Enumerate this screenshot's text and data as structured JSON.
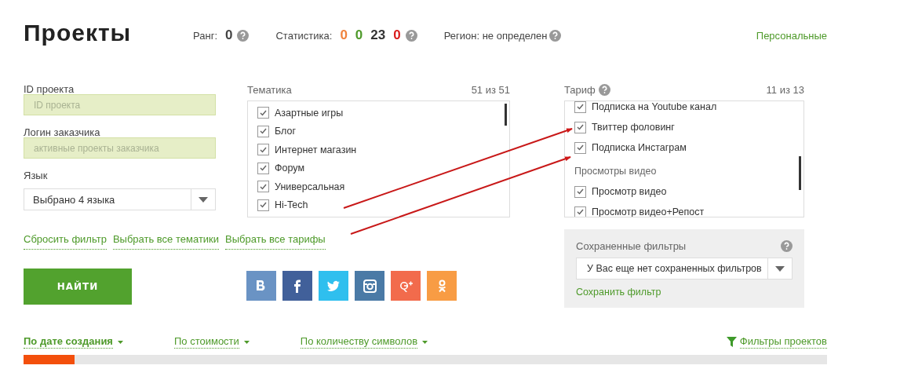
{
  "header": {
    "title": "Проекты",
    "rank_label": "Ранг:",
    "rank": "0",
    "stats_label": "Статистика:",
    "stats": [
      {
        "value": "0",
        "color": "#f0823c"
      },
      {
        "value": "0",
        "color": "#4e9a2a"
      },
      {
        "value": "23",
        "color": "#333333"
      },
      {
        "value": "0",
        "color": "#d91c1c"
      }
    ],
    "region": "Регион: не определен",
    "personal_link": "Персональные"
  },
  "fields": [
    {
      "label": "ID проекта",
      "placeholder": "ID проекта"
    },
    {
      "label": "Логин заказчика",
      "placeholder": "активные проекты заказчика"
    }
  ],
  "language": {
    "label": "Язык",
    "value": "Выбрано 4 языка"
  },
  "themes": {
    "label": "Тематика",
    "count": "51 из 51",
    "items": [
      {
        "text": "Азартные игры",
        "checked": true
      },
      {
        "text": "Блог",
        "checked": true
      },
      {
        "text": "Интернет магазин",
        "checked": true
      },
      {
        "text": "Форум",
        "checked": true
      },
      {
        "text": "Универсальная",
        "checked": true
      },
      {
        "text": "Hi-Tech",
        "checked": true
      }
    ]
  },
  "tariffs": {
    "label": "Тариф",
    "count": "11 из 13",
    "items": [
      {
        "kind": "item",
        "text": "Подписка на Youtube канал",
        "checked": true
      },
      {
        "kind": "item",
        "text": "Твиттер фоловинг",
        "checked": true
      },
      {
        "kind": "item",
        "text": "Подписка Инстаграм",
        "checked": true
      },
      {
        "kind": "group",
        "text": "Просмотры видео"
      },
      {
        "kind": "item",
        "text": "Просмотр видео",
        "checked": true
      },
      {
        "kind": "item",
        "text": "Просмотр видео+Репост",
        "checked": true
      }
    ]
  },
  "filter_links": [
    "Сбросить фильтр",
    "Выбрать все тематики",
    "Выбрать все тарифы"
  ],
  "saved_filters": {
    "title": "Сохраненные фильтры",
    "value": "У Вас еще нет сохраненных фильтров",
    "save_link": "Сохранить фильтр"
  },
  "find_button": "НАЙТИ",
  "social": [
    {
      "kind": "vk",
      "color": "#6a93c4"
    },
    {
      "kind": "facebook",
      "color": "#41609a"
    },
    {
      "kind": "twitter",
      "color": "#2fbfee"
    },
    {
      "kind": "instagram",
      "color": "#4a7aa6"
    },
    {
      "kind": "gplus",
      "color": "#f26b4c"
    },
    {
      "kind": "ok",
      "color": "#f89c44"
    }
  ],
  "sort": [
    {
      "text": "По дате создания",
      "selected": true
    },
    {
      "text": "По стоимости",
      "selected": false
    },
    {
      "text": "По количеству символов",
      "selected": false
    }
  ],
  "project_filters_link": "Фильтры проектов"
}
